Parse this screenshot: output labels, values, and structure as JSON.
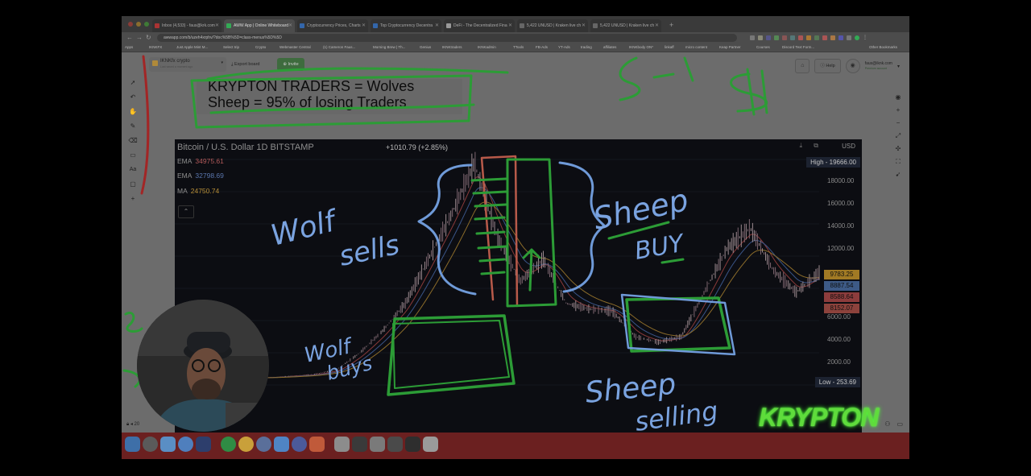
{
  "browser": {
    "tabs": [
      {
        "label": "Inbox (4,533) - faus@krk.com"
      },
      {
        "label": "AWW App | Online Whiteboard"
      },
      {
        "label": "Cryptocurrency Prices, Charts"
      },
      {
        "label": "Top Cryptocurrency Decentra"
      },
      {
        "label": "DeFi - The Decentralized Fina"
      },
      {
        "label": "5,422 UNUSD | Kraken live ch"
      },
      {
        "label": "5,422 UNUSD | Kraken live ch"
      }
    ],
    "url": "awwapp.com/b/uzeh4xrphv/?doc%5B%5D=class-menus%5D%5D",
    "bookmarks": [
      "Apps",
      "IKNKFX",
      "Just Apple Mint M...",
      "Select trip",
      "Crypto",
      "Webmaster Central",
      "(1) Cameron Faus...",
      "Morning Brew | Th...",
      "Genius",
      "IKNKtraders",
      "IKNKadmin",
      "TTools",
      "FB-Ads",
      "YT-Ads",
      "trading",
      "affiliates",
      "IKNKbody ON*",
      "linkaff",
      "micro content",
      "Keap Partner",
      "Courses",
      "Discord Text Form...",
      "Other Bookmarks"
    ]
  },
  "app": {
    "board_name": "IKNKfx crypto",
    "board_subtitle": "Last saved a moment ago",
    "export_label": "Export board",
    "invite_label": "Invite",
    "help_label": "Help",
    "user_email": "faus@iknk.com",
    "user_plan": "Premium account",
    "zoom": "20",
    "note_lines": [
      "KRYPTON TRADERS = Wolves",
      "Sheep = 95% of losing Traders"
    ]
  },
  "chart": {
    "title": "Bitcoin / U.S. Dollar  1D  BITSTAMP",
    "change": "+1010.79 (+2.85%)",
    "currency": "USD",
    "high_label": "High - 19666.00",
    "low_label": "Low - 253.69",
    "indicators": [
      {
        "name": "EMA",
        "value": "34975.61",
        "color": "#c25a5a"
      },
      {
        "name": "EMA",
        "value": "32798.69",
        "color": "#5b78b0"
      },
      {
        "name": "MA",
        "value": "24750.74",
        "color": "#c49a3a"
      }
    ],
    "y_ticks": [
      "18000.00",
      "16000.00",
      "14000.00",
      "12000.00",
      "6000.00",
      "4000.00",
      "2000.00"
    ],
    "price_badges": [
      {
        "value": "9783.25",
        "color": "#c4962c"
      },
      {
        "value": "8887.54",
        "color": "#4a6ea3"
      },
      {
        "value": "8588.64",
        "color": "#a84a4a"
      },
      {
        "value": "8152.07",
        "color": "#a8504a"
      }
    ]
  },
  "chart_data": {
    "type": "line",
    "series": [
      {
        "name": "BTC/USD",
        "values": [
          300,
          450,
          600,
          1000,
          2500,
          4500,
          7000,
          11000,
          15000,
          19666,
          13000,
          9000,
          11000,
          7000,
          6500,
          6300,
          4000,
          3500,
          4000,
          8000,
          12000,
          13800,
          10000,
          8000,
          9783
        ]
      }
    ],
    "ylim": [
      0,
      20000
    ],
    "high": 19666.0,
    "low": 253.69
  },
  "annotations": {
    "wolf_sells": [
      "Wolf",
      "sells"
    ],
    "sheep_buy": [
      "Sheep",
      "BUY"
    ],
    "wolf_buys": [
      "Wolf",
      "buys"
    ],
    "sheep_selling": [
      "Sheep",
      "selling"
    ],
    "top_scribbles": [
      "5-10",
      "$"
    ],
    "brand": "KRYPTON"
  }
}
